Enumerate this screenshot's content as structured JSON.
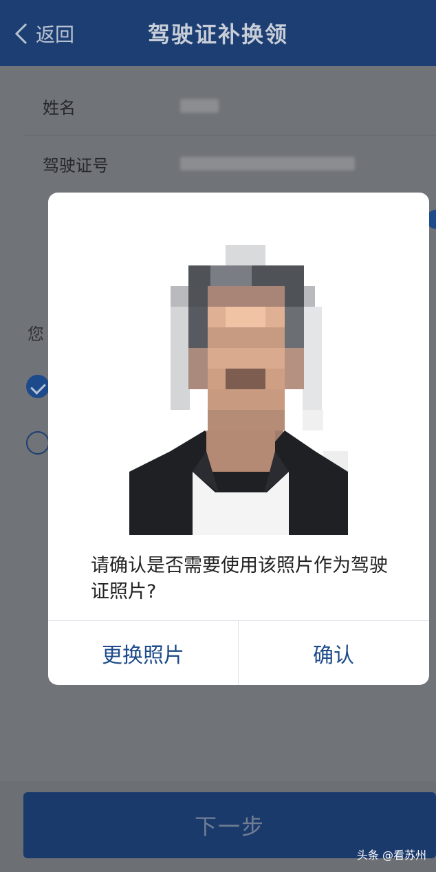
{
  "navbar": {
    "back_label": "返回",
    "title": "驾驶证补换领"
  },
  "form": {
    "rows": [
      {
        "label": "姓名"
      },
      {
        "label": "驾驶证号"
      }
    ],
    "peek_text": "您"
  },
  "dialog": {
    "message": "请确认是否需要使用该照片作为驾驶证照片?",
    "change_photo_label": "更换照片",
    "confirm_label": "确认"
  },
  "next_button_label": "下一步",
  "watermark": "头条 @看苏州",
  "colors": {
    "nav_bar": "#1d3e73",
    "accent": "#1d4a8a",
    "dialog_bg": "#ffffff"
  }
}
